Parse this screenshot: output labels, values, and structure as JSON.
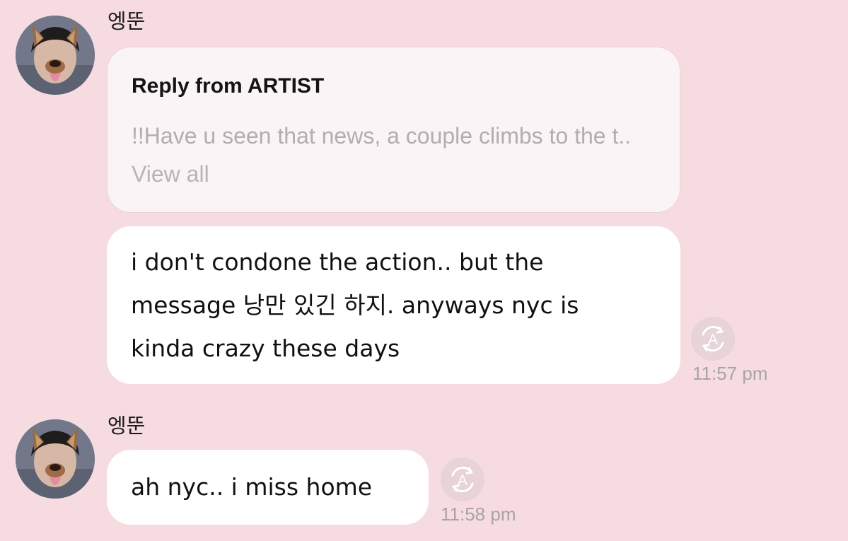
{
  "messages": [
    {
      "sender": "엥뚠",
      "reply": {
        "title": "Reply from ARTIST",
        "preview": "!!Have u seen that news, a couple climbs to the t..",
        "view_all": "View all"
      },
      "text_lines": [
        "i don't condone the action.. but the",
        "message 낭만 있긴 하지. anyways nyc is",
        "kinda crazy these days"
      ],
      "time": "11:57 pm",
      "translate_icon": "translate-a-icon"
    },
    {
      "sender": "엥뚠",
      "text_lines": [
        "ah nyc.. i miss home"
      ],
      "time": "11:58 pm",
      "translate_icon": "translate-a-icon"
    }
  ],
  "colors": {
    "background": "#f6dce1",
    "bubble": "#ffffff",
    "reply_bubble": "#fbf4f6",
    "muted_text": "#b3adaf",
    "icon_circle": "#e7d3d8"
  }
}
